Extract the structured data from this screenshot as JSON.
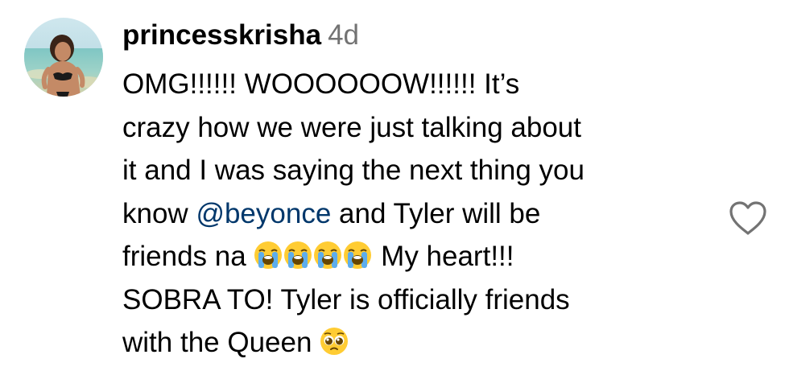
{
  "comment": {
    "username": "princesskrisha",
    "time": "4d",
    "lines": [
      "OMG!!!!!! WOOOOOOW!!!!!! It’s",
      "crazy how we were just talking about",
      "it and I was saying the next thing you"
    ],
    "line4_pre": "know ",
    "mention": "@beyonce",
    "line4_post": " and Tyler will be",
    "line5_pre": "friends na ",
    "line5_post": " My heart!!!",
    "line6": "SOBRA TO! Tyler is officially friends",
    "line7_pre": "with the Queen ",
    "emojis_line5": [
      "loudly-crying-face",
      "loudly-crying-face",
      "loudly-crying-face",
      "loudly-crying-face"
    ],
    "emoji_line7": "pleading-face"
  },
  "icons": {
    "avatar": "profile-photo",
    "like": "heart-outline-icon"
  },
  "colors": {
    "text": "#000000",
    "muted": "#737373",
    "mention": "#00376b"
  }
}
